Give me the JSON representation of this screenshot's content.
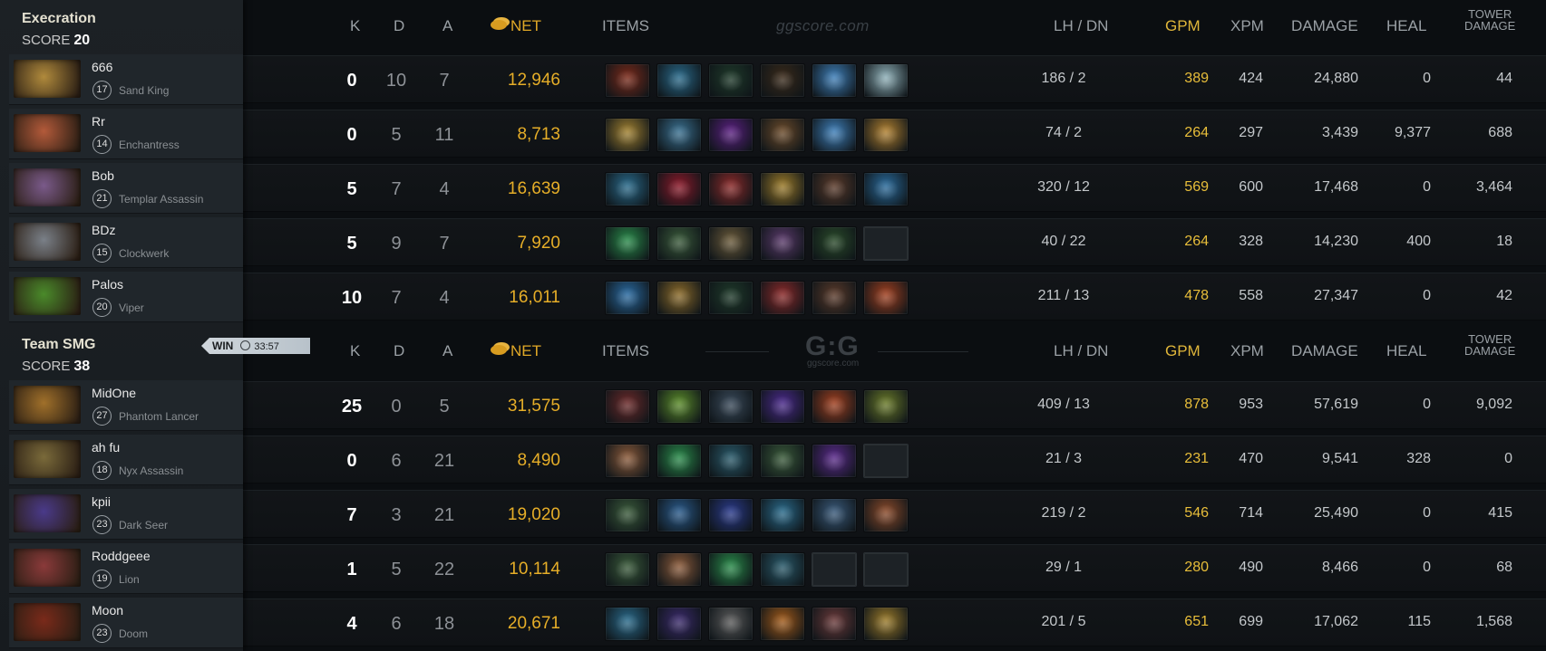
{
  "watermark_top": "ggscore.com",
  "watermark_mid_logo": "G:G",
  "watermark_mid_sub": "ggscore.com",
  "headers": {
    "k": "K",
    "d": "D",
    "a": "A",
    "net": "NET",
    "items": "ITEMS",
    "lhdn": "LH  /  DN",
    "gpm": "GPM",
    "xpm": "XPM",
    "damage": "DAMAGE",
    "heal": "HEAL",
    "tower1": "TOWER",
    "tower2": "DAMAGE"
  },
  "result": {
    "label": "WIN",
    "time": "33:57",
    "icon": "clock-icon"
  },
  "teams": [
    {
      "name": "Execration",
      "score_label": "SCORE",
      "score": "20",
      "players": [
        {
          "name": "666",
          "level": "17",
          "hero": "Sand King",
          "k": "0",
          "d": "10",
          "a": "7",
          "net": "12,946",
          "lhdn": "186  /  2",
          "gpm": "389",
          "xpm": "424",
          "damage": "24,880",
          "heal": "0",
          "tower": "44",
          "portrait": "#b08a3c",
          "items": [
            "#7a2a1a",
            "#2a6a8a",
            "#1f3a2a",
            "#3a2a1a",
            "#3f7fb8",
            "#8fb0b8"
          ]
        },
        {
          "name": "Rr",
          "level": "14",
          "hero": "Enchantress",
          "k": "0",
          "d": "5",
          "a": "11",
          "net": "8,713",
          "lhdn": "74  /  2",
          "gpm": "264",
          "xpm": "297",
          "damage": "3,439",
          "heal": "9,377",
          "tower": "688",
          "portrait": "#b35a3a",
          "items": [
            "#a08030",
            "#3a7090",
            "#5a2080",
            "#6a4a2a",
            "#3f7fb8",
            "#b08030"
          ]
        },
        {
          "name": "Bob",
          "level": "21",
          "hero": "Templar Assassin",
          "k": "5",
          "d": "7",
          "a": "4",
          "net": "16,639",
          "lhdn": "320  /  12",
          "gpm": "569",
          "xpm": "600",
          "damage": "17,468",
          "heal": "0",
          "tower": "3,464",
          "portrait": "#7a5a8a",
          "items": [
            "#2a6a8a",
            "#8a1a2a",
            "#8a2a2a",
            "#9a7a2a",
            "#5a3a2a",
            "#2a6a9a"
          ]
        },
        {
          "name": "BDz",
          "level": "15",
          "hero": "Clockwerk",
          "k": "5",
          "d": "9",
          "a": "7",
          "net": "7,920",
          "lhdn": "40  /  22",
          "gpm": "264",
          "xpm": "328",
          "damage": "14,230",
          "heal": "400",
          "tower": "18",
          "portrait": "#7a8088",
          "items": [
            "#2a8a4a",
            "#3a5a3a",
            "#6a5a3a",
            "#5a3a6a",
            "#2a4a2a",
            "empty"
          ]
        },
        {
          "name": "Palos",
          "level": "20",
          "hero": "Viper",
          "k": "10",
          "d": "7",
          "a": "4",
          "net": "16,011",
          "lhdn": "211  /  13",
          "gpm": "478",
          "xpm": "558",
          "damage": "27,347",
          "heal": "0",
          "tower": "42",
          "portrait": "#4a8a2a",
          "items": [
            "#2a6aa0",
            "#8a6a2a",
            "#1f3a2a",
            "#8a2a2a",
            "#5a3a2a",
            "#a04020"
          ]
        }
      ]
    },
    {
      "name": "Team SMG",
      "score_label": "SCORE",
      "score": "38",
      "players": [
        {
          "name": "MidOne",
          "level": "27",
          "hero": "Phantom Lancer",
          "k": "25",
          "d": "0",
          "a": "5",
          "net": "31,575",
          "lhdn": "409  /  13",
          "gpm": "878",
          "xpm": "953",
          "damage": "57,619",
          "heal": "0",
          "tower": "9,092",
          "portrait": "#a0702a",
          "items": [
            "#6a2a2a",
            "#5a8a2a",
            "#3a4a5a",
            "#4a2a8a",
            "#a04020",
            "#6a7a2a"
          ]
        },
        {
          "name": "ah fu",
          "level": "18",
          "hero": "Nyx Assassin",
          "k": "0",
          "d": "6",
          "a": "21",
          "net": "8,490",
          "lhdn": "21  /  3",
          "gpm": "231",
          "xpm": "470",
          "damage": "9,541",
          "heal": "328",
          "tower": "0",
          "portrait": "#7a6a3a",
          "items": [
            "#8a5a3a",
            "#2a8a4a",
            "#2a5a6a",
            "#3a5a3a",
            "#5a2a8a",
            "empty"
          ]
        },
        {
          "name": "kpii",
          "level": "23",
          "hero": "Dark Seer",
          "k": "7",
          "d": "3",
          "a": "21",
          "net": "19,020",
          "lhdn": "219  /  2",
          "gpm": "546",
          "xpm": "714",
          "damage": "25,490",
          "heal": "0",
          "tower": "415",
          "portrait": "#4a3a8a",
          "items": [
            "#3a5a3a",
            "#2a5a8a",
            "#2a3a8a",
            "#2a6a8a",
            "#3a5a7a",
            "#8a4a2a"
          ]
        },
        {
          "name": "Roddgeee",
          "level": "19",
          "hero": "Lion",
          "k": "1",
          "d": "5",
          "a": "22",
          "net": "10,114",
          "lhdn": "29  /  1",
          "gpm": "280",
          "xpm": "490",
          "damage": "8,466",
          "heal": "0",
          "tower": "68",
          "portrait": "#8a3a3a",
          "items": [
            "#3a5a3a",
            "#8a5a3a",
            "#2a8a4a",
            "#2a5a6a",
            "empty",
            "empty"
          ]
        },
        {
          "name": "Moon",
          "level": "23",
          "hero": "Doom",
          "k": "4",
          "d": "6",
          "a": "18",
          "net": "20,671",
          "lhdn": "201  /  5",
          "gpm": "651",
          "xpm": "699",
          "damage": "17,062",
          "heal": "115",
          "tower": "1,568",
          "portrait": "#7a2a1a",
          "items": [
            "#2a6a8a",
            "#3a2a6a",
            "#5a5a5a",
            "#a05a1a",
            "#6a3a3a",
            "#9a7a2a"
          ]
        }
      ]
    }
  ]
}
